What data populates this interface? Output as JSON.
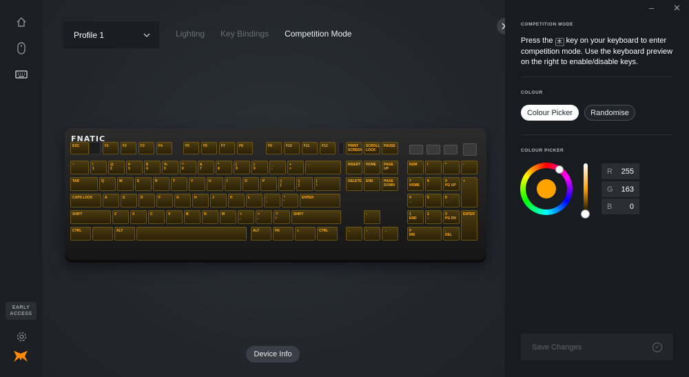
{
  "rail": {
    "items": [
      "home-icon",
      "mouse-icon",
      "keyboard-icon"
    ],
    "early_access": "EARLY ACCESS",
    "settings_icon": "gear-icon",
    "logo_icon": "fnatic-logo"
  },
  "header": {
    "profile": "Profile 1",
    "tabs": [
      {
        "label": "Lighting",
        "active": false
      },
      {
        "label": "Key Bindings",
        "active": false
      },
      {
        "label": "Competition Mode",
        "active": true
      }
    ]
  },
  "keyboard": {
    "brand": "FNATIC",
    "accent": "#ffb01f",
    "keys": [
      [
        "ESC"
      ],
      [
        ""
      ],
      [
        "F1"
      ],
      [
        "F2"
      ],
      [
        "F3"
      ],
      [
        "F4"
      ],
      [
        "F5"
      ],
      [
        "F6"
      ],
      [
        "F7"
      ],
      [
        "F8"
      ],
      [
        "F9"
      ],
      [
        "F10"
      ],
      [
        "F11"
      ],
      [
        "F12"
      ],
      [
        ""
      ],
      [
        "PRINT SCREEN"
      ],
      [
        "SCROLL LOCK"
      ],
      [
        "PAUSE"
      ],
      [
        "~"
      ],
      [
        "!",
        "1"
      ],
      [
        "@",
        "2"
      ],
      [
        "#",
        "3"
      ],
      [
        "$",
        "4"
      ],
      [
        "%",
        "5"
      ],
      [
        "^",
        "6"
      ],
      [
        "&",
        "7"
      ],
      [
        "*",
        "8"
      ],
      [
        "(",
        "9"
      ],
      [
        ")",
        "0"
      ],
      [
        "_",
        "-"
      ],
      [
        "+",
        "="
      ],
      [
        "←"
      ],
      [
        "INSERT"
      ],
      [
        "HOME"
      ],
      [
        "PAGE UP"
      ],
      [
        "NUM"
      ],
      [
        "/"
      ],
      [
        "*"
      ],
      [
        "-"
      ],
      [
        "TAB"
      ],
      [
        "Q"
      ],
      [
        "W"
      ],
      [
        "E"
      ],
      [
        "R"
      ],
      [
        "T"
      ],
      [
        "Y"
      ],
      [
        "U"
      ],
      [
        "I"
      ],
      [
        "O"
      ],
      [
        "P"
      ],
      [
        "{",
        "["
      ],
      [
        "}",
        "]"
      ],
      [
        "|",
        "\\"
      ],
      [
        "DELETE"
      ],
      [
        "END"
      ],
      [
        "PAGE DOWN"
      ],
      [
        "7",
        "HOME"
      ],
      [
        "8",
        "↑"
      ],
      [
        "9",
        "PG UP"
      ],
      [
        "+"
      ],
      [
        "CAPS LOCK"
      ],
      [
        "A"
      ],
      [
        "S"
      ],
      [
        "D"
      ],
      [
        "F"
      ],
      [
        "G"
      ],
      [
        "H"
      ],
      [
        "J"
      ],
      [
        "K"
      ],
      [
        "L"
      ],
      [
        ":",
        ";"
      ],
      [
        "\"",
        "'"
      ],
      [
        "ENTER"
      ],
      [
        "4",
        "←"
      ],
      [
        "5"
      ],
      [
        "6",
        "→"
      ],
      [
        "SHIFT"
      ],
      [
        "Z"
      ],
      [
        "X"
      ],
      [
        "C"
      ],
      [
        "V"
      ],
      [
        "B"
      ],
      [
        "N"
      ],
      [
        "M"
      ],
      [
        "<",
        ","
      ],
      [
        ">",
        "."
      ],
      [
        "?",
        "/"
      ],
      [
        "SHIFT"
      ],
      [
        "↑"
      ],
      [
        "1",
        "END"
      ],
      [
        "2",
        "↓"
      ],
      [
        "3",
        "PG DN"
      ],
      [
        "ENTER"
      ],
      [
        "CTRL"
      ],
      [
        ""
      ],
      [
        "ALT"
      ],
      [
        ""
      ],
      [
        "ALT"
      ],
      [
        "FN"
      ],
      [
        "≡"
      ],
      [
        "CTRL"
      ],
      [
        "←"
      ],
      [
        "↓"
      ],
      [
        "→"
      ],
      [
        "0",
        "INS"
      ],
      [
        ".",
        "DEL"
      ]
    ]
  },
  "device_info": "Device Info",
  "panel": {
    "section_title": "COMPETITION MODE",
    "description_before": "Press the",
    "description_key": "⽊",
    "description_after": "key on your keyboard to enter competition mode. Use the keyboard preview on the right to enable/disable keys.",
    "colour_label": "COLOUR",
    "colour_picker_btn": "Colour Picker",
    "randomise_btn": "Randomise",
    "picker_label": "COLOUR PICKER",
    "current_colour": "#ffa300",
    "rgb": [
      {
        "label": "R",
        "value": "255"
      },
      {
        "label": "G",
        "value": "163"
      },
      {
        "label": "B",
        "value": "0"
      }
    ],
    "save_label": "Save Changes"
  },
  "window": {
    "minimize": "–",
    "close": "✕"
  }
}
